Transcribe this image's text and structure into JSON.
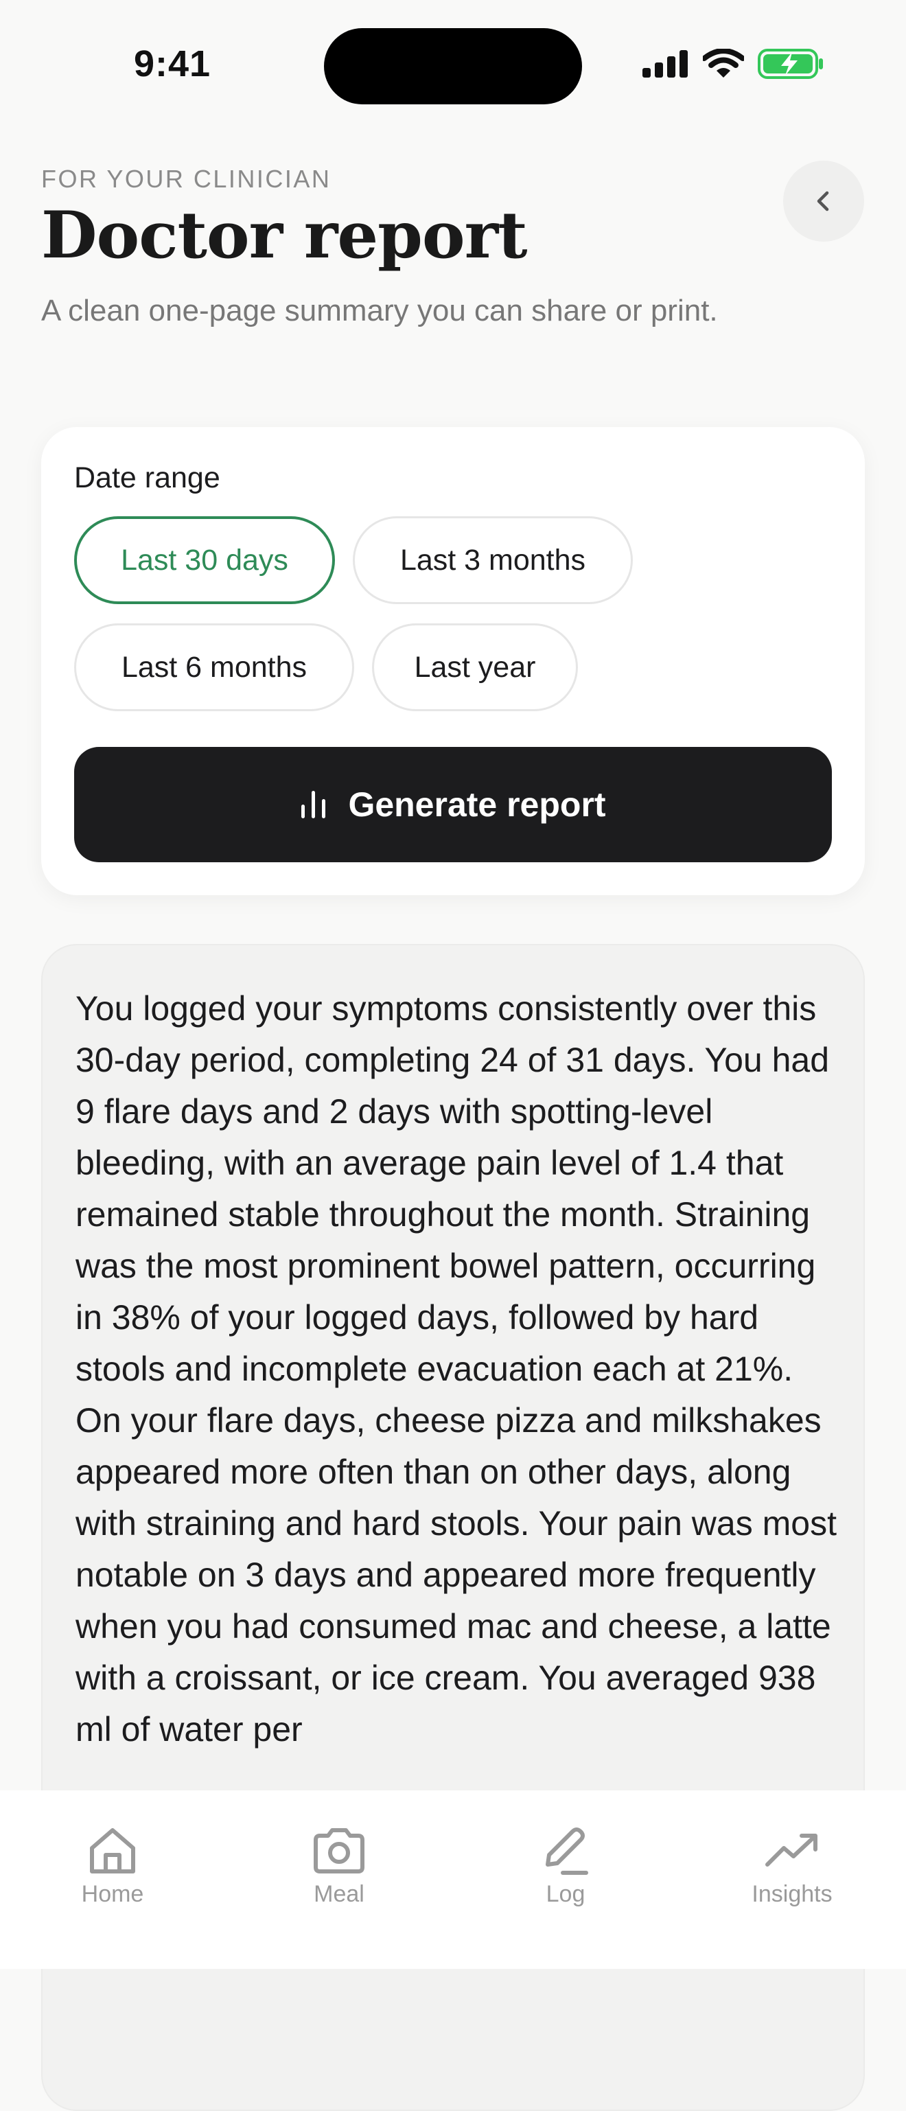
{
  "status_bar": {
    "time": "9:41"
  },
  "header": {
    "eyebrow": "FOR YOUR CLINICIAN",
    "title": "Doctor report",
    "subtitle": "A clean one-page summary you can share or print."
  },
  "date_range": {
    "label": "Date range",
    "options": [
      "Last 30 days",
      "Last 3 months",
      "Last 6 months",
      "Last year"
    ],
    "selected": "Last 30 days"
  },
  "generate_button": {
    "label": "Generate report",
    "icon": "bar-chart-icon"
  },
  "summary": {
    "text": "You logged your symptoms consistently over this 30-day period, completing 24 of 31 days. You had 9 flare days and 2 days with spotting-level bleeding, with an average pain level of 1.4 that remained stable throughout the month. Straining was the most prominent bowel pattern, occurring in 38% of your logged days, followed by hard stools and incomplete evacuation each at 21%. On your flare days, cheese pizza and milkshakes appeared more often than on other days, along with straining and hard stools. Your pain was most notable on 3 days and appeared more frequently when you had consumed mac and cheese, a latte with a croissant, or ice cream. You averaged 938 ml of water per"
  },
  "tab_bar": {
    "tabs": [
      {
        "label": "Home",
        "icon": "home-icon"
      },
      {
        "label": "Meal",
        "icon": "camera-icon"
      },
      {
        "label": "Log",
        "icon": "pencil-icon"
      },
      {
        "label": "Insights",
        "icon": "trend-icon"
      }
    ]
  },
  "colors": {
    "accent": "#2e8b57",
    "button_dark": "#1c1c1e",
    "battery": "#34c759"
  }
}
